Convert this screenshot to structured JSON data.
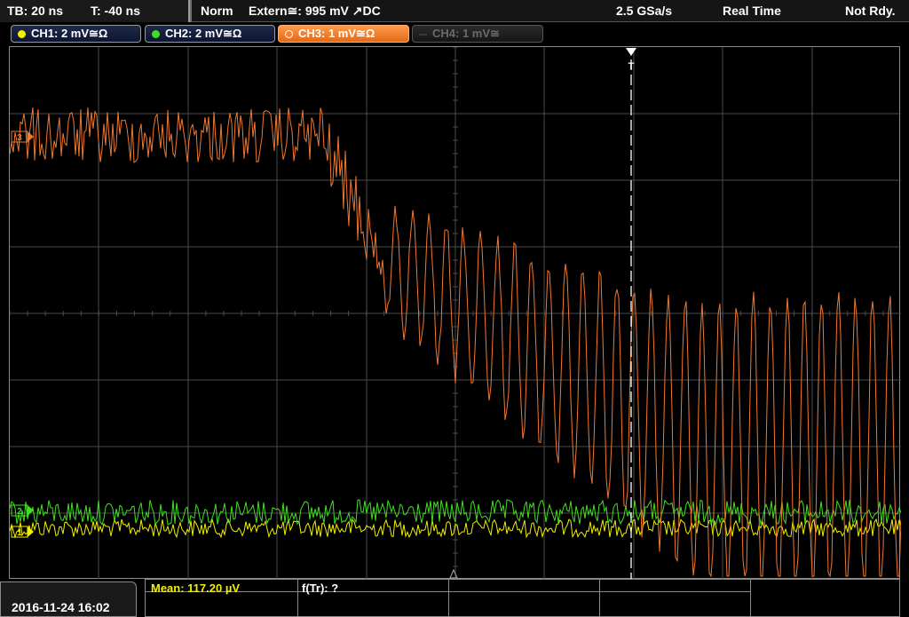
{
  "topbar": {
    "timebase": "TB: 20 ns",
    "trigger_offset": "T: -40 ns",
    "trigger_mode": "Norm",
    "trigger_source": "Extern≅: 995 mV ↗DC",
    "sample_rate": "2.5 GSa/s",
    "acq_mode": "Real Time",
    "status": "Not Rdy."
  },
  "channels": [
    {
      "label": "CH1: 2 mV≅Ω",
      "color": "#f0f000",
      "state": "on"
    },
    {
      "label": "CH2: 2 mV≅Ω",
      "color": "#40e020",
      "state": "on"
    },
    {
      "label": "CH3: 1 mV≅Ω",
      "color": "#ff7f27",
      "state": "active"
    },
    {
      "label": "CH4: 1 mV≅",
      "color": "#5a5a5a",
      "state": "off"
    }
  ],
  "markers": {
    "trigger": "T",
    "ch3_ref": "3",
    "ch2_ref": "2",
    "ch1_ref": "1"
  },
  "colors": {
    "ch1": "#f0f000",
    "ch2": "#40e020",
    "ch3": "#f07830",
    "grid": "#4a4a4a",
    "trigger_line": "#ffffff"
  },
  "bottom": {
    "datetime": "2016-11-24 16:02",
    "measurement_1": "Mean: 117.20 µV",
    "measurement_2": "f(Tr): ?"
  }
}
